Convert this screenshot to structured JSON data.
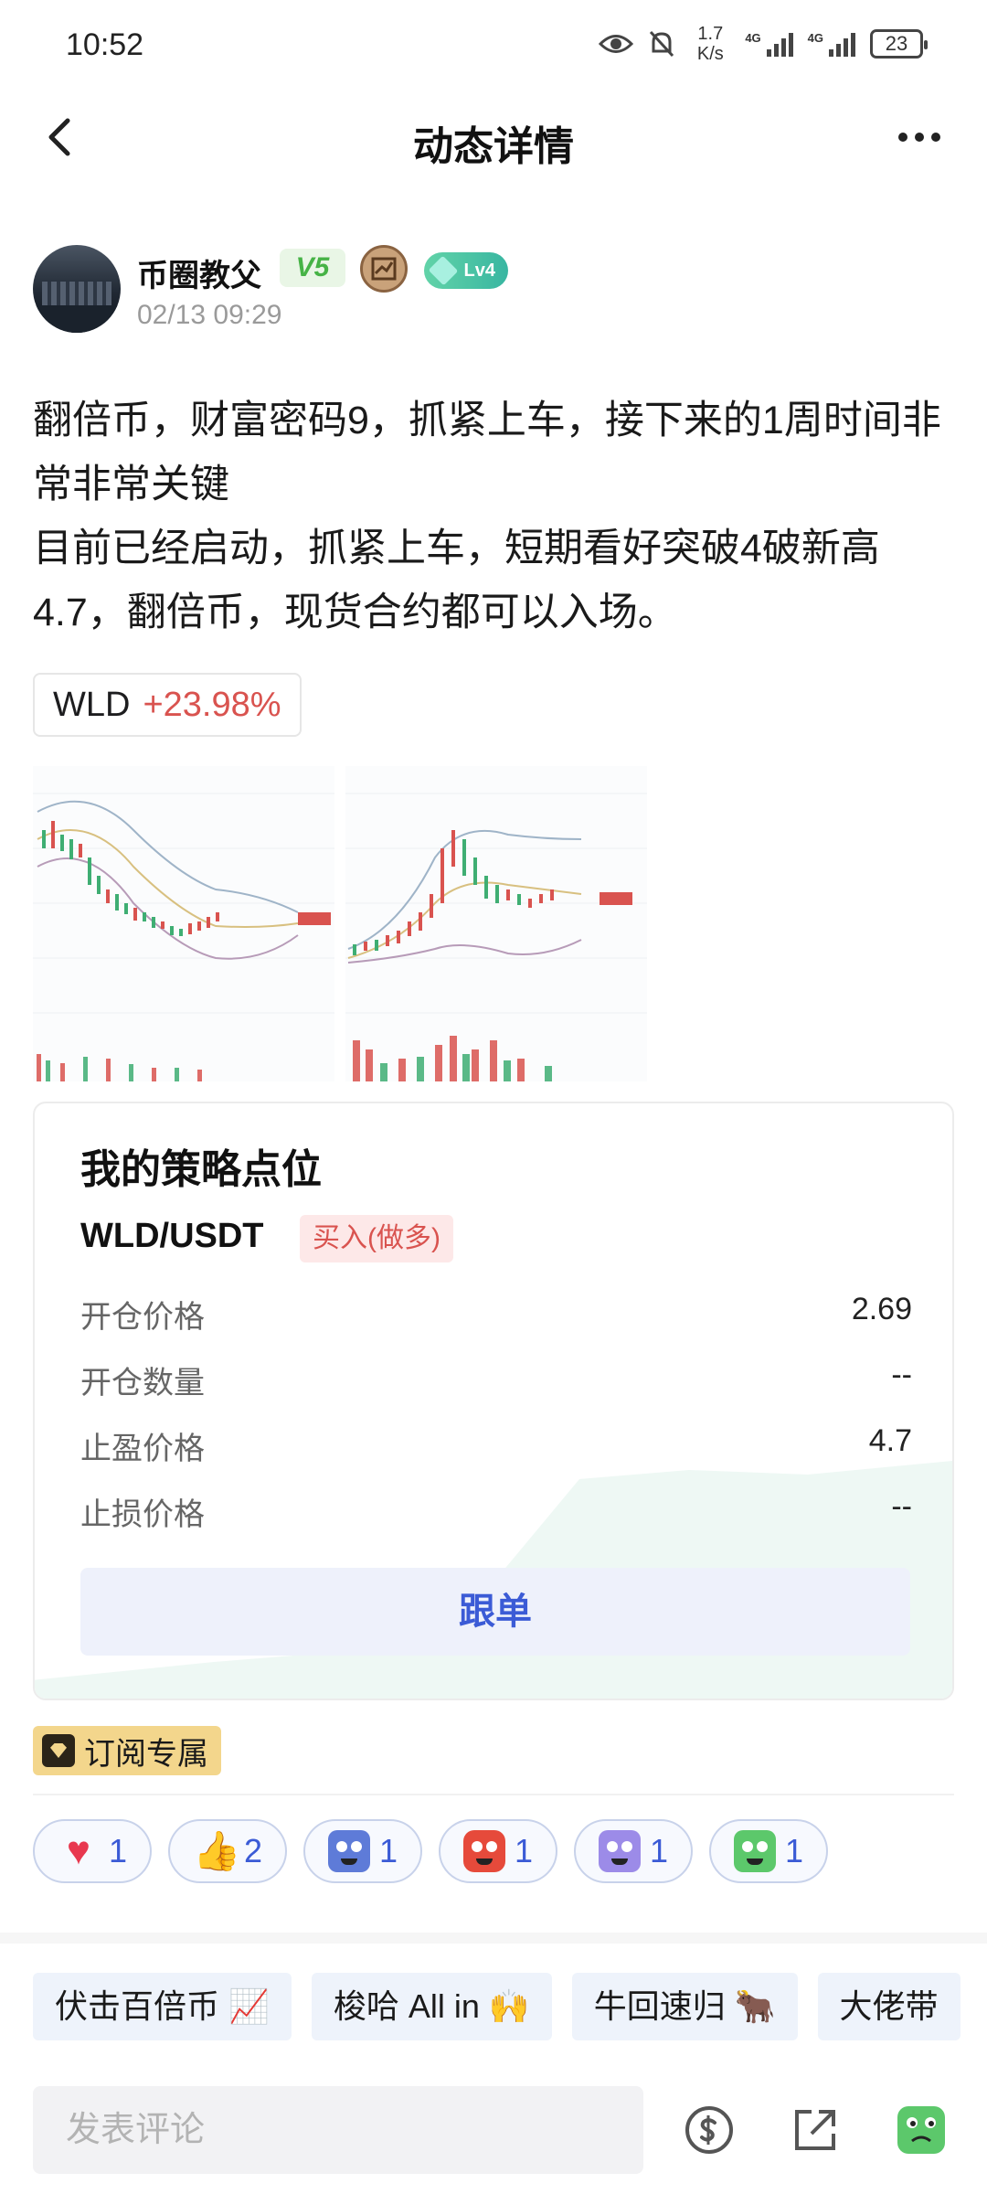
{
  "status_bar": {
    "time": "10:52",
    "speed_top": "1.7",
    "speed_bottom": "K/s",
    "network_1": "4G",
    "network_2": "4G",
    "battery": "23"
  },
  "header": {
    "title": "动态详情"
  },
  "author": {
    "name": "币圈教父",
    "vip_tag": "V5",
    "level": "Lv4",
    "time": "02/13 09:29"
  },
  "post": {
    "paragraph_1": "翻倍币，财富密码9，抓紧上车，接下来的1周时间非常非常关键",
    "paragraph_2": "目前已经启动，抓紧上车，短期看好突破4破新高4.7，翻倍币，现货合约都可以入场。"
  },
  "coin": {
    "symbol": "WLD",
    "change": "+23.98%"
  },
  "strategy": {
    "title": "我的策略点位",
    "pair": "WLD/USDT",
    "direction": "买入(做多)",
    "rows": [
      {
        "label": "开仓价格",
        "value": "2.69"
      },
      {
        "label": "开仓数量",
        "value": "--"
      },
      {
        "label": "止盈价格",
        "value": "4.7"
      },
      {
        "label": "止损价格",
        "value": "--"
      }
    ],
    "follow_label": "跟单"
  },
  "subscription": {
    "label": "订阅专属"
  },
  "reactions": [
    {
      "icon": "heart-icon",
      "count": "1"
    },
    {
      "icon": "thumbs-up-icon",
      "count": "2"
    },
    {
      "icon": "hodl-emoji-icon",
      "count": "1"
    },
    {
      "icon": "angry-emoji-icon",
      "count": "1"
    },
    {
      "icon": "robot-emoji-icon",
      "count": "1"
    },
    {
      "icon": "crying-emoji-icon",
      "count": "1"
    }
  ],
  "topics": [
    "伏击百倍币 📈",
    "梭哈 All in 🙌",
    "牛回速归 🐂",
    "大佬带"
  ],
  "comment": {
    "placeholder": "发表评论"
  },
  "colors": {
    "accent_blue": "#3b5bd6",
    "up_red": "#d9534f",
    "vip_green": "#46b346",
    "gold_tag": "#f3d68c"
  }
}
